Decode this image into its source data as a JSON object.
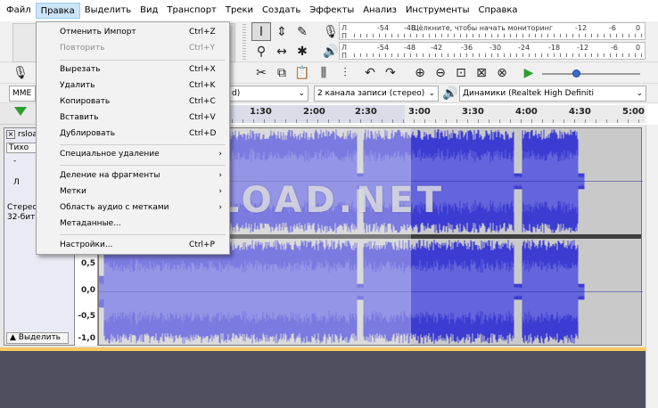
{
  "menubar": {
    "items": [
      "Файл",
      "Правка",
      "Выделить",
      "Вид",
      "Транспорт",
      "Треки",
      "Создать",
      "Эффекты",
      "Анализ",
      "Инструменты",
      "Справка"
    ]
  },
  "toolbar": {
    "rec_meter": {
      "lr": "Л\nП",
      "scale": [
        "-54",
        "-48",
        "-12",
        "-6",
        "0"
      ],
      "hint": "Щёлкните, чтобы начать мониторинг"
    },
    "play_meter": {
      "lr": "Л\nП",
      "scale": [
        "-54",
        "-48",
        "-42",
        "-36",
        "-30",
        "-24",
        "-18",
        "-12",
        "-6",
        "0"
      ]
    },
    "host_partial": "MME",
    "rec_device_partial": "d)",
    "channels": "2 канала записи (стерео)",
    "output_device": "Динамики (Realtek High Definiti"
  },
  "timeline": {
    "labels": [
      "1:30",
      "2:00",
      "2:30",
      "3:00",
      "3:30",
      "4:00",
      "4:30",
      "5:00"
    ]
  },
  "track": {
    "name_partial": "rsloa",
    "mute_partial": "Тихо",
    "minus": "-",
    "letter_l": "Л",
    "info_line1": "Стерео",
    "info_line2": "32-бит",
    "collapse": "Выделить",
    "close": "×"
  },
  "ruler": {
    "labels": [
      "0,5",
      "0,0",
      "-0,5",
      "-1,0"
    ]
  },
  "watermark": {
    "text": "RSLOAD.NET"
  },
  "edit_menu": {
    "items": [
      {
        "label": "Отменить Импорт",
        "shortcut": "Ctrl+Z",
        "disabled": false,
        "submenu": false
      },
      {
        "label": "Повторить",
        "shortcut": "Ctrl+Y",
        "disabled": true,
        "submenu": false
      },
      {
        "label": "Вырезать",
        "shortcut": "Ctrl+X",
        "disabled": false,
        "submenu": false
      },
      {
        "label": "Удалить",
        "shortcut": "Ctrl+K",
        "disabled": false,
        "submenu": false
      },
      {
        "label": "Копировать",
        "shortcut": "Ctrl+C",
        "disabled": false,
        "submenu": false
      },
      {
        "label": "Вставить",
        "shortcut": "Ctrl+V",
        "disabled": false,
        "submenu": false
      },
      {
        "label": "Дублировать",
        "shortcut": "Ctrl+D",
        "disabled": false,
        "submenu": false
      },
      {
        "label": "Специальное удаление",
        "shortcut": "",
        "disabled": false,
        "submenu": true
      },
      {
        "label": "Деление на фрагменты",
        "shortcut": "",
        "disabled": false,
        "submenu": true
      },
      {
        "label": "Метки",
        "shortcut": "",
        "disabled": false,
        "submenu": true
      },
      {
        "label": "Область аудио с метками",
        "shortcut": "",
        "disabled": false,
        "submenu": true
      },
      {
        "label": "Метаданные...",
        "shortcut": "",
        "disabled": false,
        "submenu": false
      },
      {
        "label": "Настройки...",
        "shortcut": "Ctrl+P",
        "disabled": false,
        "submenu": false
      }
    ],
    "submenu_arrow": "›"
  },
  "colors": {
    "waveform": "#3c3cd2",
    "waveform_rms": "#6464dc",
    "menu_highlight": "#cce4f7"
  }
}
